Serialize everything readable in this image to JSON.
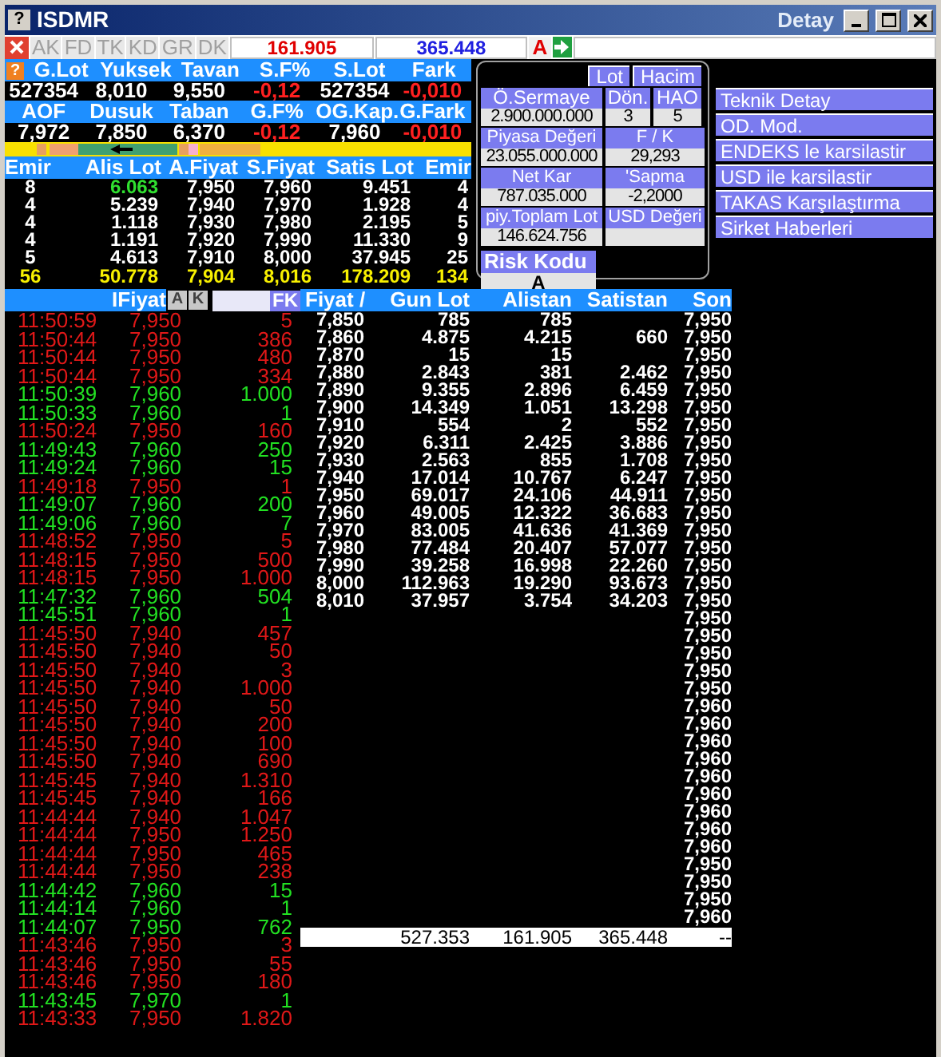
{
  "window": {
    "help": "?",
    "title": "ISDMR",
    "subtitle": "Detay"
  },
  "toolbar": {
    "buttons": [
      {
        "label": "AK",
        "disabled": true
      },
      {
        "label": "FD",
        "disabled": true
      },
      {
        "label": "TK",
        "disabled": true
      },
      {
        "label": "KD",
        "disabled": true
      },
      {
        "label": "GR",
        "disabled": true
      },
      {
        "label": "DK",
        "disabled": true
      }
    ],
    "field_1": "161.905",
    "field_2": "365.448",
    "mode": "A"
  },
  "stats_help": "?",
  "stats": [
    {
      "headers": [
        "G.Lot",
        "Yuksek",
        "Tavan",
        "S.F%",
        "S.Lot",
        "Fark"
      ],
      "values": [
        {
          "text": "527354",
          "negative": false
        },
        {
          "text": "8,010",
          "negative": false
        },
        {
          "text": "9,550",
          "negative": false
        },
        {
          "text": "-0,12",
          "negative": true
        },
        {
          "text": "527354",
          "negative": false
        },
        {
          "text": "-0,010",
          "negative": true
        }
      ]
    },
    {
      "headers": [
        "AOF",
        "Dusuk",
        "Taban",
        "G.F%",
        "OG.Kap.",
        "G.Fark"
      ],
      "values": [
        {
          "text": "7,972",
          "negative": false
        },
        {
          "text": "7,850",
          "negative": false
        },
        {
          "text": "6,370",
          "negative": false
        },
        {
          "text": "-0,12",
          "negative": true
        },
        {
          "text": "7,960",
          "negative": false
        },
        {
          "text": "-0,010",
          "negative": true
        }
      ]
    }
  ],
  "depth": {
    "columns": [
      "Emir",
      "Alis Lot",
      "A.Fiyat",
      "S.Fiyat",
      "Satis Lot",
      "Emir"
    ],
    "rows": [
      {
        "cells": [
          "8",
          "6.063",
          "7,950",
          "7,960",
          "9.451",
          "4"
        ],
        "highlighted": true
      },
      {
        "cells": [
          "4",
          "5.239",
          "7,940",
          "7,970",
          "1.928",
          "4"
        ],
        "highlighted": false
      },
      {
        "cells": [
          "4",
          "1.118",
          "7,930",
          "7,980",
          "2.195",
          "5"
        ],
        "highlighted": false
      },
      {
        "cells": [
          "4",
          "1.191",
          "7,920",
          "7,990",
          "11.330",
          "9"
        ],
        "highlighted": false
      },
      {
        "cells": [
          "5",
          "4.613",
          "7,910",
          "8,000",
          "37.945",
          "25"
        ],
        "highlighted": false
      }
    ],
    "totals": [
      "56",
      "50.778",
      "7,904",
      "8,016",
      "178.209",
      "134"
    ]
  },
  "info_panel": {
    "buttons": [
      "Lot",
      "Hacim"
    ],
    "fields": [
      {
        "label": "Ö.Sermaye",
        "value": "2.900.000.000"
      },
      {
        "label": "Dön.",
        "value": "3"
      },
      {
        "label": "HAO",
        "value": "5"
      },
      {
        "label": "Piyasa Değeri",
        "value": "23.055.000.000"
      },
      {
        "label": "F / K",
        "value": "29,293"
      },
      {
        "label": "Net Kar",
        "value": "787.035.000"
      },
      {
        "label": "'Sapma",
        "value": "-2,2000"
      },
      {
        "label": "piy.Toplam Lot",
        "value": "146.624.756"
      },
      {
        "label": "USD Değeri"
      }
    ],
    "risk": {
      "label": "Risk Kodu",
      "value": "A"
    }
  },
  "menu": [
    "Teknik Detay",
    "OD. Mod.",
    "ENDEKS le karsilastir",
    "USD ile karsilastir",
    "TAKAS Karşılaştırma",
    "Sirket Haberleri"
  ],
  "trades": {
    "header": "IFiyat",
    "buttons": [
      "A",
      "K",
      "FK"
    ],
    "rows": [
      {
        "time": "11:50:59",
        "price": "7,950",
        "lot": "5",
        "color": "#e01818"
      },
      {
        "time": "11:50:44",
        "price": "7,950",
        "lot": "386",
        "color": "#e01818"
      },
      {
        "time": "11:50:44",
        "price": "7,950",
        "lot": "480",
        "color": "#e01818"
      },
      {
        "time": "11:50:44",
        "price": "7,950",
        "lot": "334",
        "color": "#e01818"
      },
      {
        "time": "11:50:39",
        "price": "7,960",
        "lot": "1.000",
        "color": "#22e022"
      },
      {
        "time": "11:50:33",
        "price": "7,960",
        "lot": "1",
        "color": "#22e022"
      },
      {
        "time": "11:50:24",
        "price": "7,950",
        "lot": "160",
        "color": "#e01818"
      },
      {
        "time": "11:49:43",
        "price": "7,960",
        "lot": "250",
        "color": "#22e022"
      },
      {
        "time": "11:49:24",
        "price": "7,960",
        "lot": "15",
        "color": "#22e022"
      },
      {
        "time": "11:49:18",
        "price": "7,950",
        "lot": "1",
        "color": "#e01818"
      },
      {
        "time": "11:49:07",
        "price": "7,960",
        "lot": "200",
        "color": "#22e022"
      },
      {
        "time": "11:49:06",
        "price": "7,960",
        "lot": "7",
        "color": "#22e022"
      },
      {
        "time": "11:48:52",
        "price": "7,950",
        "lot": "5",
        "color": "#e01818"
      },
      {
        "time": "11:48:15",
        "price": "7,950",
        "lot": "500",
        "color": "#e01818"
      },
      {
        "time": "11:48:15",
        "price": "7,950",
        "lot": "1.000",
        "color": "#e01818"
      },
      {
        "time": "11:47:32",
        "price": "7,960",
        "lot": "504",
        "color": "#22e022"
      },
      {
        "time": "11:45:51",
        "price": "7,960",
        "lot": "1",
        "color": "#22e022"
      },
      {
        "time": "11:45:50",
        "price": "7,940",
        "lot": "457",
        "color": "#e01818"
      },
      {
        "time": "11:45:50",
        "price": "7,940",
        "lot": "50",
        "color": "#e01818"
      },
      {
        "time": "11:45:50",
        "price": "7,940",
        "lot": "3",
        "color": "#e01818"
      },
      {
        "time": "11:45:50",
        "price": "7,940",
        "lot": "1.000",
        "color": "#e01818"
      },
      {
        "time": "11:45:50",
        "price": "7,940",
        "lot": "50",
        "color": "#e01818"
      },
      {
        "time": "11:45:50",
        "price": "7,940",
        "lot": "200",
        "color": "#e01818"
      },
      {
        "time": "11:45:50",
        "price": "7,940",
        "lot": "100",
        "color": "#e01818"
      },
      {
        "time": "11:45:50",
        "price": "7,940",
        "lot": "690",
        "color": "#e01818"
      },
      {
        "time": "11:45:45",
        "price": "7,940",
        "lot": "1.310",
        "color": "#e01818"
      },
      {
        "time": "11:45:45",
        "price": "7,940",
        "lot": "166",
        "color": "#e01818"
      },
      {
        "time": "11:44:44",
        "price": "7,940",
        "lot": "1.047",
        "color": "#e01818"
      },
      {
        "time": "11:44:44",
        "price": "7,950",
        "lot": "1.250",
        "color": "#e01818"
      },
      {
        "time": "11:44:44",
        "price": "7,950",
        "lot": "465",
        "color": "#e01818"
      },
      {
        "time": "11:44:44",
        "price": "7,950",
        "lot": "238",
        "color": "#e01818"
      },
      {
        "time": "11:44:42",
        "price": "7,960",
        "lot": "15",
        "color": "#22e022"
      },
      {
        "time": "11:44:14",
        "price": "7,960",
        "lot": "1",
        "color": "#22e022"
      },
      {
        "time": "11:44:07",
        "price": "7,950",
        "lot": "762",
        "color": "#22e022"
      },
      {
        "time": "11:43:46",
        "price": "7,950",
        "lot": "3",
        "color": "#e01818"
      },
      {
        "time": "11:43:46",
        "price": "7,950",
        "lot": "55",
        "color": "#e01818"
      },
      {
        "time": "11:43:46",
        "price": "7,950",
        "lot": "180",
        "color": "#e01818"
      },
      {
        "time": "11:43:45",
        "price": "7,970",
        "lot": "1",
        "color": "#22e022"
      },
      {
        "time": "11:43:33",
        "price": "7,950",
        "lot": "1.820",
        "color": "#e01818"
      }
    ]
  },
  "price_table": {
    "columns": [
      "Fiyat /",
      "Gun Lot",
      "Alistan",
      "Satistan",
      "Son"
    ],
    "rows": [
      [
        "7,850",
        "785",
        "785",
        "",
        "7,950"
      ],
      [
        "7,860",
        "4.875",
        "4.215",
        "660",
        "7,950"
      ],
      [
        "7,870",
        "15",
        "15",
        "",
        "7,950"
      ],
      [
        "7,880",
        "2.843",
        "381",
        "2.462",
        "7,950"
      ],
      [
        "7,890",
        "9.355",
        "2.896",
        "6.459",
        "7,950"
      ],
      [
        "7,900",
        "14.349",
        "1.051",
        "13.298",
        "7,950"
      ],
      [
        "7,910",
        "554",
        "2",
        "552",
        "7,950"
      ],
      [
        "7,920",
        "6.311",
        "2.425",
        "3.886",
        "7,950"
      ],
      [
        "7,930",
        "2.563",
        "855",
        "1.708",
        "7,950"
      ],
      [
        "7,940",
        "17.014",
        "10.767",
        "6.247",
        "7,950"
      ],
      [
        "7,950",
        "69.017",
        "24.106",
        "44.911",
        "7,950"
      ],
      [
        "7,960",
        "49.005",
        "12.322",
        "36.683",
        "7,950"
      ],
      [
        "7,970",
        "83.005",
        "41.636",
        "41.369",
        "7,950"
      ],
      [
        "7,980",
        "77.484",
        "20.407",
        "57.077",
        "7,950"
      ],
      [
        "7,990",
        "39.258",
        "16.998",
        "22.260",
        "7,950"
      ],
      [
        "8,000",
        "112.963",
        "19.290",
        "93.673",
        "7,950"
      ],
      [
        "8,010",
        "37.957",
        "3.754",
        "34.203",
        "7,950"
      ],
      [
        "",
        "",
        "",
        "",
        "7,950"
      ],
      [
        "",
        "",
        "",
        "",
        "7,950"
      ],
      [
        "",
        "",
        "",
        "",
        "7,950"
      ],
      [
        "",
        "",
        "",
        "",
        "7,950"
      ],
      [
        "",
        "",
        "",
        "",
        "7,950"
      ],
      [
        "",
        "",
        "",
        "",
        "7,960"
      ],
      [
        "",
        "",
        "",
        "",
        "7,960"
      ],
      [
        "",
        "",
        "",
        "",
        "7,960"
      ],
      [
        "",
        "",
        "",
        "",
        "7,960"
      ],
      [
        "",
        "",
        "",
        "",
        "7,960"
      ],
      [
        "",
        "",
        "",
        "",
        "7,960"
      ],
      [
        "",
        "",
        "",
        "",
        "7,960"
      ],
      [
        "",
        "",
        "",
        "",
        "7,960"
      ],
      [
        "",
        "",
        "",
        "",
        "7,960"
      ],
      [
        "",
        "",
        "",
        "",
        "7,950"
      ],
      [
        "",
        "",
        "",
        "",
        "7,950"
      ],
      [
        "",
        "",
        "",
        "",
        "7,950"
      ],
      [
        "",
        "",
        "",
        "",
        "7,960"
      ]
    ],
    "footer": [
      "527.353",
      "161.905",
      "365.448",
      "--"
    ]
  }
}
